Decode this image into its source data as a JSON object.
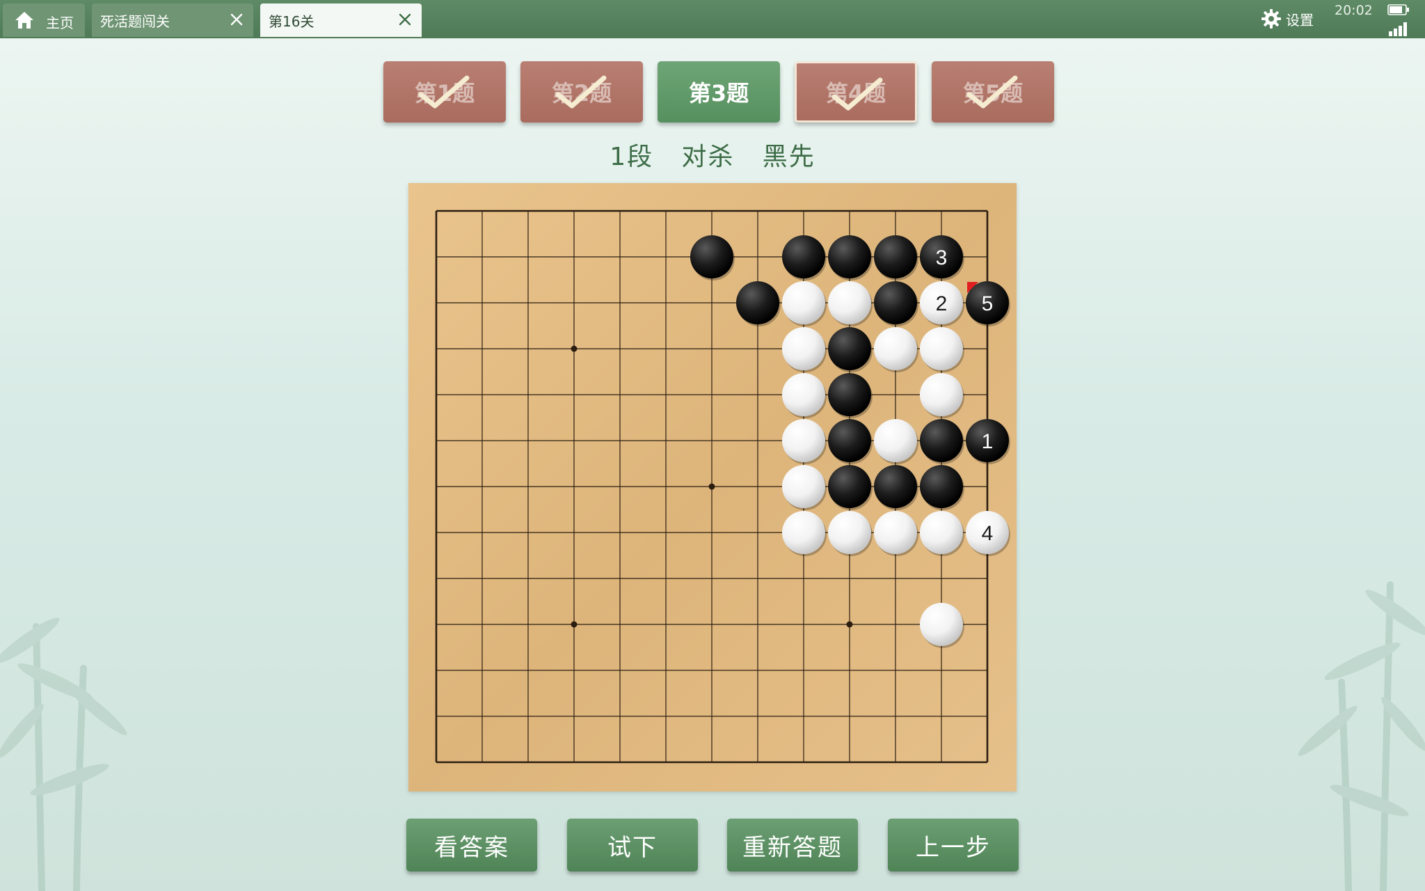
{
  "topbar": {
    "home_label": "主页",
    "tabs": [
      {
        "label": "死活题闯关"
      },
      {
        "label": "第16关"
      }
    ],
    "settings_label": "设置",
    "clock": "20:02"
  },
  "problem_tabs": [
    {
      "label": "第1题",
      "solved": true
    },
    {
      "label": "第2题",
      "solved": true
    },
    {
      "label": "第3题",
      "solved": false,
      "current": true
    },
    {
      "label": "第4题",
      "solved": true
    },
    {
      "label": "第5题",
      "solved": true
    }
  ],
  "problem": {
    "rank": "1段",
    "type": "对杀",
    "to_play": "黑先"
  },
  "board": {
    "size": 13,
    "stones": [
      {
        "color": "black",
        "col": 6,
        "row": 1
      },
      {
        "color": "black",
        "col": 8,
        "row": 1
      },
      {
        "color": "black",
        "col": 9,
        "row": 1
      },
      {
        "color": "black",
        "col": 10,
        "row": 1
      },
      {
        "color": "black",
        "col": 11,
        "row": 1,
        "label": "3"
      },
      {
        "color": "black",
        "col": 7,
        "row": 2
      },
      {
        "color": "white",
        "col": 8,
        "row": 2
      },
      {
        "color": "white",
        "col": 9,
        "row": 2
      },
      {
        "color": "black",
        "col": 10,
        "row": 2
      },
      {
        "color": "white",
        "col": 11,
        "row": 2,
        "label": "2"
      },
      {
        "color": "black",
        "col": 12,
        "row": 2,
        "label": "5",
        "last": true
      },
      {
        "color": "white",
        "col": 8,
        "row": 3
      },
      {
        "color": "black",
        "col": 9,
        "row": 3
      },
      {
        "color": "white",
        "col": 10,
        "row": 3
      },
      {
        "color": "white",
        "col": 11,
        "row": 3
      },
      {
        "color": "white",
        "col": 8,
        "row": 4
      },
      {
        "color": "black",
        "col": 9,
        "row": 4
      },
      {
        "color": "white",
        "col": 11,
        "row": 4
      },
      {
        "color": "white",
        "col": 8,
        "row": 5
      },
      {
        "color": "black",
        "col": 9,
        "row": 5
      },
      {
        "color": "white",
        "col": 10,
        "row": 5
      },
      {
        "color": "black",
        "col": 11,
        "row": 5
      },
      {
        "color": "black",
        "col": 12,
        "row": 5,
        "label": "1"
      },
      {
        "color": "white",
        "col": 8,
        "row": 6
      },
      {
        "color": "black",
        "col": 9,
        "row": 6
      },
      {
        "color": "black",
        "col": 10,
        "row": 6
      },
      {
        "color": "black",
        "col": 11,
        "row": 6
      },
      {
        "color": "white",
        "col": 8,
        "row": 7
      },
      {
        "color": "white",
        "col": 9,
        "row": 7
      },
      {
        "color": "white",
        "col": 10,
        "row": 7
      },
      {
        "color": "white",
        "col": 11,
        "row": 7
      },
      {
        "color": "white",
        "col": 12,
        "row": 7,
        "label": "4"
      },
      {
        "color": "white",
        "col": 11,
        "row": 9
      }
    ],
    "star_points": [
      [
        3,
        3
      ],
      [
        6,
        6
      ],
      [
        3,
        9
      ],
      [
        9,
        9
      ]
    ]
  },
  "buttons": {
    "answer": "看答案",
    "try": "试下",
    "retry": "重新答题",
    "undo": "上一步"
  },
  "colors": {
    "accent_green": "#56905f",
    "solved_red": "#a96c5e",
    "board_wood": "#e2bb82",
    "last_move_marker": "#e02020"
  }
}
